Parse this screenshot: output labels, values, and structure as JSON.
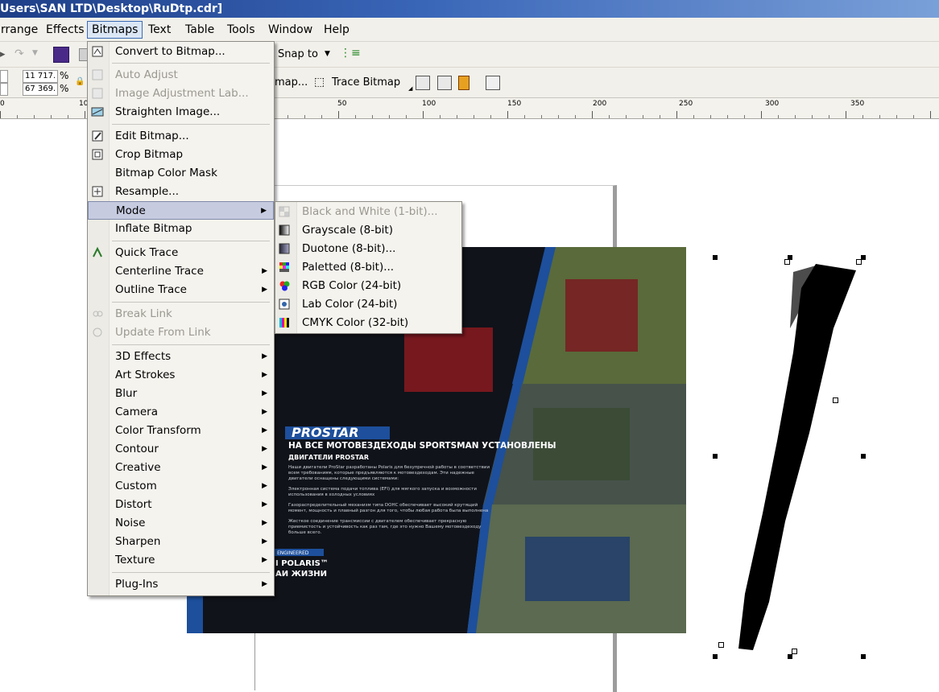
{
  "window": {
    "title": "Users\\SAN LTD\\Desktop\\RuDtp.cdr]"
  },
  "menubar": {
    "items": [
      "rrange",
      "Effects",
      "Bitmaps",
      "Text",
      "Table",
      "Tools",
      "Window",
      "Help"
    ],
    "active": "Bitmaps"
  },
  "toolbar": {
    "snap_label": "Snap to",
    "x_value": "11 717.",
    "y_value": "67 369.",
    "pct1": "%",
    "pct2": "%",
    "bitmap_label": "map...",
    "trace_label": "Trace Bitmap"
  },
  "ruler": {
    "ticks": [
      "0",
      "10",
      "50",
      "100",
      "150",
      "200",
      "250",
      "300",
      "350"
    ]
  },
  "bitmaps_menu": {
    "items": [
      {
        "label": "Convert to Bitmap...",
        "icon": "convert-bitmap-icon"
      },
      {
        "label": "Auto Adjust",
        "icon": "auto-adjust-icon"
      },
      {
        "label": "Image Adjustment Lab...",
        "icon": "adjustment-lab-icon"
      },
      {
        "label": "Straighten Image...",
        "icon": "straighten-icon"
      },
      {
        "label": "Edit Bitmap...",
        "icon": "edit-bitmap-icon"
      },
      {
        "label": "Crop Bitmap",
        "icon": "crop-bitmap-icon"
      },
      {
        "label": "Bitmap Color Mask",
        "icon": ""
      },
      {
        "label": "Resample...",
        "icon": "resample-icon"
      },
      {
        "label": "Mode",
        "icon": ""
      },
      {
        "label": "Inflate Bitmap",
        "icon": ""
      },
      {
        "label": "Quick Trace",
        "icon": "quick-trace-icon"
      },
      {
        "label": "Centerline Trace",
        "icon": ""
      },
      {
        "label": "Outline Trace",
        "icon": ""
      },
      {
        "label": "Break Link",
        "icon": "break-link-icon"
      },
      {
        "label": "Update From Link",
        "icon": "update-link-icon"
      },
      {
        "label": "3D Effects",
        "icon": ""
      },
      {
        "label": "Art Strokes",
        "icon": ""
      },
      {
        "label": "Blur",
        "icon": ""
      },
      {
        "label": "Camera",
        "icon": ""
      },
      {
        "label": "Color Transform",
        "icon": ""
      },
      {
        "label": "Contour",
        "icon": ""
      },
      {
        "label": "Creative",
        "icon": ""
      },
      {
        "label": "Custom",
        "icon": ""
      },
      {
        "label": "Distort",
        "icon": ""
      },
      {
        "label": "Noise",
        "icon": ""
      },
      {
        "label": "Sharpen",
        "icon": ""
      },
      {
        "label": "Texture",
        "icon": ""
      },
      {
        "label": "Plug-Ins",
        "icon": ""
      }
    ]
  },
  "mode_submenu": {
    "items": [
      {
        "label": "Black and White (1-bit)...",
        "icon": "bw-icon"
      },
      {
        "label": "Grayscale (8-bit)",
        "icon": "grayscale-icon"
      },
      {
        "label": "Duotone (8-bit)...",
        "icon": "duotone-icon"
      },
      {
        "label": "Paletted (8-bit)...",
        "icon": "paletted-icon"
      },
      {
        "label": "RGB Color (24-bit)",
        "icon": "rgb-icon"
      },
      {
        "label": "Lab Color (24-bit)",
        "icon": "lab-icon"
      },
      {
        "label": "CMYK Color (32-bit)",
        "icon": "cmyk-icon"
      }
    ]
  },
  "document": {
    "brand": "PROSTAR",
    "headline": "НА ВСЕ МОТОВЕЗДЕХОДЫ SPORTSMAN УСТАНОВЛЕНЫ",
    "subhead": "ДВИГАТЕЛИ PROSTAR",
    "engineered": "ENGINEERED",
    "polaris1": "I POLARIS™",
    "polaris2": "АИ ЖИЗНИ",
    "para1": "Наши двигатели ProStar разработаны Polaris для безупречной работы в соответствии всем требованиям, которые предъявляются к мотовездеходам. Эти надежные двигатели оснащены следующими системами:",
    "para2": "Электронная система подачи топлива (EFI) для мягкого запуска и возможности использования в холодных условиях",
    "para3": "Газораспределительный механизм типа DOHC обеспечивает высокий крутящий момент, мощность и плавный разгон для того, чтобы любая работа была выполнена",
    "para4": "Жесткое соединение трансмиссии с двигателем обеспечивает прекрасную приемистость и устойчивость как раз там, где это нужно Вашему мотовездеходу больше всего."
  },
  "colors": {
    "accent": "#3c6bb5",
    "menu_bg": "#f5f3ee",
    "highlight": "#c6cbe0",
    "dark_page": "#0f1218",
    "stripe": "#1d4f9c"
  }
}
